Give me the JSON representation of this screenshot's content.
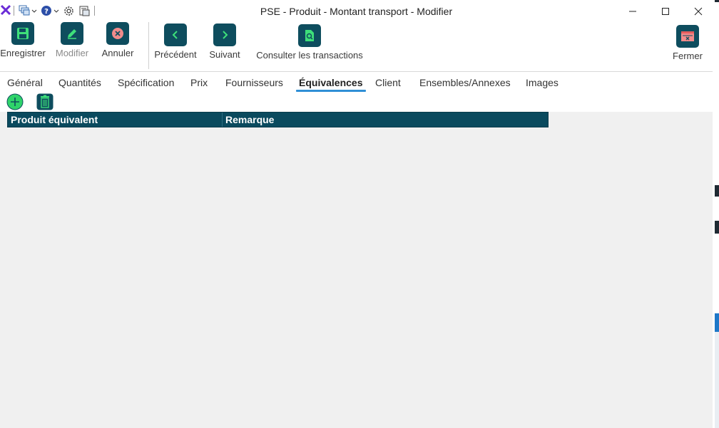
{
  "window": {
    "title": "PSE - Produit - Montant transport - Modifier"
  },
  "quick_access": {
    "icons": [
      "app-logo-icon",
      "layers-icon",
      "help-icon",
      "settings-icon",
      "report-icon"
    ]
  },
  "toolbar": {
    "save_label": "Enregistrer",
    "edit_label": "Modifier",
    "cancel_label": "Annuler",
    "previous_label": "Précédent",
    "next_label": "Suivant",
    "transactions_label": "Consulter les transactions",
    "close_label": "Fermer"
  },
  "tabs": [
    {
      "label": "Général"
    },
    {
      "label": "Quantités"
    },
    {
      "label": "Spécification"
    },
    {
      "label": "Prix"
    },
    {
      "label": "Fournisseurs"
    },
    {
      "label": "Équivalences"
    },
    {
      "label": "Client"
    },
    {
      "label": "Ensembles/Annexes"
    },
    {
      "label": "Images"
    }
  ],
  "active_tab": "Équivalences",
  "grid": {
    "columns": [
      "Produit équivalent",
      "Remarque"
    ],
    "rows": []
  },
  "colors": {
    "accent": "#0e4d5e",
    "tab_underline": "#2f8fd6",
    "add_button": "#2fd36a",
    "cancel_icon": "#f28b8b"
  }
}
